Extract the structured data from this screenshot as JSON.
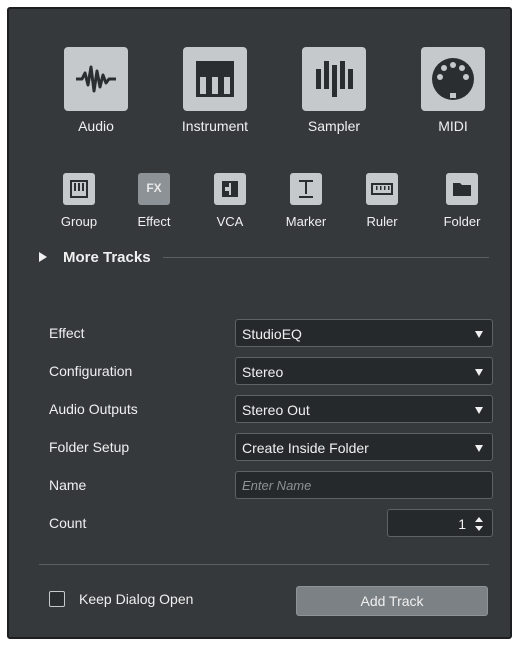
{
  "track_types": [
    {
      "label": "Audio",
      "icon": "audio-waveform-icon"
    },
    {
      "label": "Instrument",
      "icon": "piano-keys-icon"
    },
    {
      "label": "Sampler",
      "icon": "sampler-bars-icon"
    },
    {
      "label": "MIDI",
      "icon": "midi-connector-icon"
    }
  ],
  "small_types": [
    {
      "label": "Group",
      "icon": "group-icon"
    },
    {
      "label": "Effect",
      "icon": "fx-icon",
      "badge": "FX"
    },
    {
      "label": "VCA",
      "icon": "vca-icon"
    },
    {
      "label": "Marker",
      "icon": "marker-icon"
    },
    {
      "label": "Ruler",
      "icon": "ruler-icon"
    },
    {
      "label": "Folder",
      "icon": "folder-icon"
    }
  ],
  "more_tracks": {
    "label": "More Tracks"
  },
  "form": {
    "effect": {
      "label": "Effect",
      "value": "StudioEQ"
    },
    "configuration": {
      "label": "Configuration",
      "value": "Stereo"
    },
    "audio_outputs": {
      "label": "Audio Outputs",
      "value": "Stereo Out"
    },
    "folder_setup": {
      "label": "Folder Setup",
      "value": "Create Inside Folder"
    },
    "name": {
      "label": "Name",
      "placeholder": "Enter Name"
    },
    "count": {
      "label": "Count",
      "value": "1"
    }
  },
  "footer": {
    "keep_open_label": "Keep Dialog Open",
    "keep_open_checked": false,
    "add_button": "Add Track"
  },
  "colors": {
    "background": "#35393c",
    "tile": "#c6c9cb",
    "tile_active": "#8d9296",
    "field": "#25292b",
    "button": "#7c8185"
  }
}
